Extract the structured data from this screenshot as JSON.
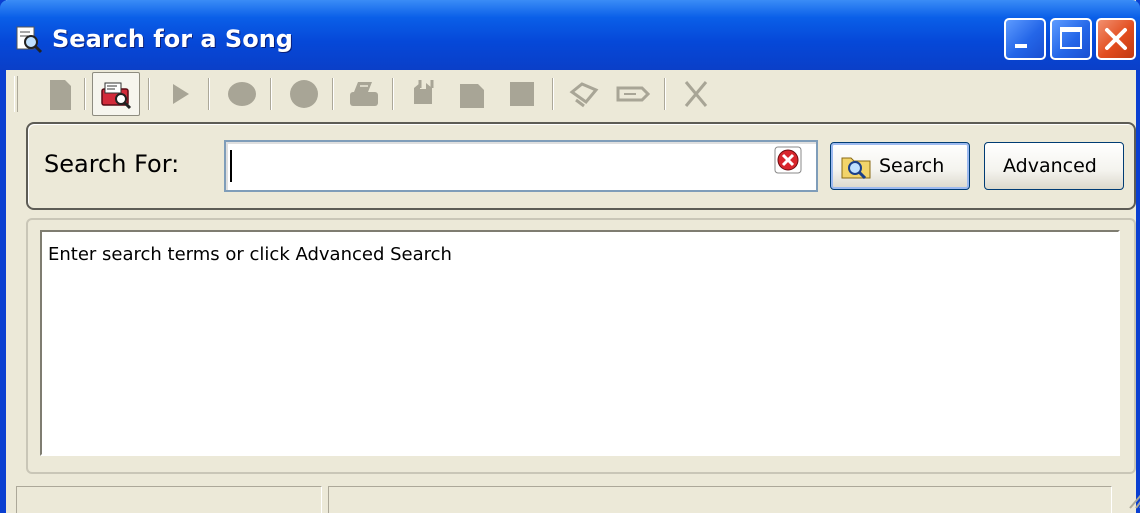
{
  "window": {
    "title": "Search for a Song",
    "title_icon": "song-search-icon",
    "controls": [
      "minimize-icon",
      "maximize-icon",
      "close-icon"
    ]
  },
  "toolbar": {
    "items": [
      {
        "icon": "document-icon",
        "active": false
      },
      {
        "icon": "song-search-icon",
        "active": true
      },
      {
        "icon": "play-icon",
        "active": false
      },
      {
        "icon": "record-icon",
        "active": false
      },
      {
        "icon": "record-alt-icon",
        "active": false
      },
      {
        "icon": "print-icon",
        "active": false
      },
      {
        "icon": "compare-icon",
        "active": false
      },
      {
        "icon": "copy-icon",
        "active": false
      },
      {
        "icon": "stop-icon",
        "active": false
      },
      {
        "icon": "tag-icon",
        "active": false
      },
      {
        "icon": "label-icon",
        "active": false
      },
      {
        "icon": "delete-icon",
        "active": false
      }
    ]
  },
  "search": {
    "label": "Search For:",
    "value": "",
    "search_button": "Search",
    "advanced_button": "Advanced"
  },
  "results": {
    "message": "Enter search terms or click Advanced Search"
  },
  "colors": {
    "titlebar": "#0a5fe8",
    "window_bg": "#ece9d8",
    "close_button": "#e24d1f"
  }
}
